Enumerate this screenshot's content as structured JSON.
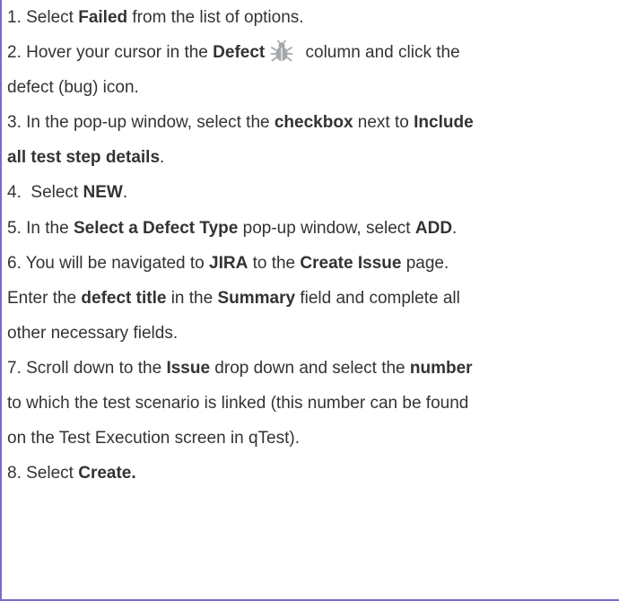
{
  "steps": {
    "s1": {
      "num": "1. Select ",
      "b1": "Failed",
      "t1": " from the list of options."
    },
    "s2": {
      "num": "2. Hover your cursor in the ",
      "b1": "Defect",
      "t1": " column and click the",
      "cont": "defect (bug) icon.",
      "icon": "bug-icon"
    },
    "s3": {
      "num": "3. In the pop-up window, select the ",
      "b1": "checkbox",
      "t1": " next to ",
      "b2": "Include",
      "cont_b": "all test step details",
      "cont_t": "."
    },
    "s4": {
      "num": "4.  Select ",
      "b1": "NEW",
      "t1": "."
    },
    "s5": {
      "num": "5. In the ",
      "b1": "Select a Defect Type",
      "t1": " pop-up window, select ",
      "b2": "ADD",
      "t2": "."
    },
    "s6": {
      "num": "6. You will be navigated to ",
      "b1": "JIRA",
      "t1": " to the ",
      "b2": "Create Issue",
      "t2": " page.",
      "l2_a": "Enter the ",
      "l2_b1": "defect title",
      "l2_t1": " in the ",
      "l2_b2": "Summary",
      "l2_t2": " field and complete all",
      "l3": "other necessary fields."
    },
    "s7": {
      "num": "7. Scroll down to the ",
      "b1": "Issue",
      "t1": " drop down and select the ",
      "b2": "number",
      "l2": "to which the test scenario is linked (this number can be found",
      "l3": "on the Test Execution screen in qTest)."
    },
    "s8": {
      "num": "8. Select ",
      "b1": "Create."
    }
  }
}
